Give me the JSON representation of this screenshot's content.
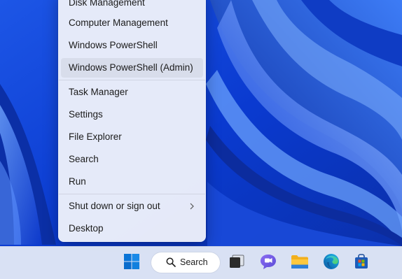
{
  "menu": {
    "items": [
      {
        "label": "Disk Management"
      },
      {
        "label": "Computer Management"
      },
      {
        "label": "Windows PowerShell"
      },
      {
        "label": "Windows PowerShell (Admin)"
      },
      {
        "label": "Task Manager"
      },
      {
        "label": "Settings"
      },
      {
        "label": "File Explorer"
      },
      {
        "label": "Search"
      },
      {
        "label": "Run"
      },
      {
        "label": "Shut down or sign out",
        "submenu_icon": "chevron-right-icon"
      },
      {
        "label": "Desktop"
      }
    ],
    "hovered_item": "Windows PowerShell (Admin)"
  },
  "taskbar": {
    "start_icon": "windows-logo-icon",
    "search": {
      "label": "Search",
      "icon": "search-icon"
    },
    "apps": [
      {
        "icon": "task-view-icon"
      },
      {
        "icon": "teams-chat-icon"
      },
      {
        "icon": "file-explorer-icon"
      },
      {
        "icon": "edge-browser-icon"
      },
      {
        "icon": "microsoft-store-icon"
      }
    ]
  },
  "colors": {
    "wallpaper_base": "#0a3fd8",
    "menu_bg": "#ecf0fa",
    "taskbar_bg": "#e2e8f6",
    "accent": "#0067c0"
  }
}
